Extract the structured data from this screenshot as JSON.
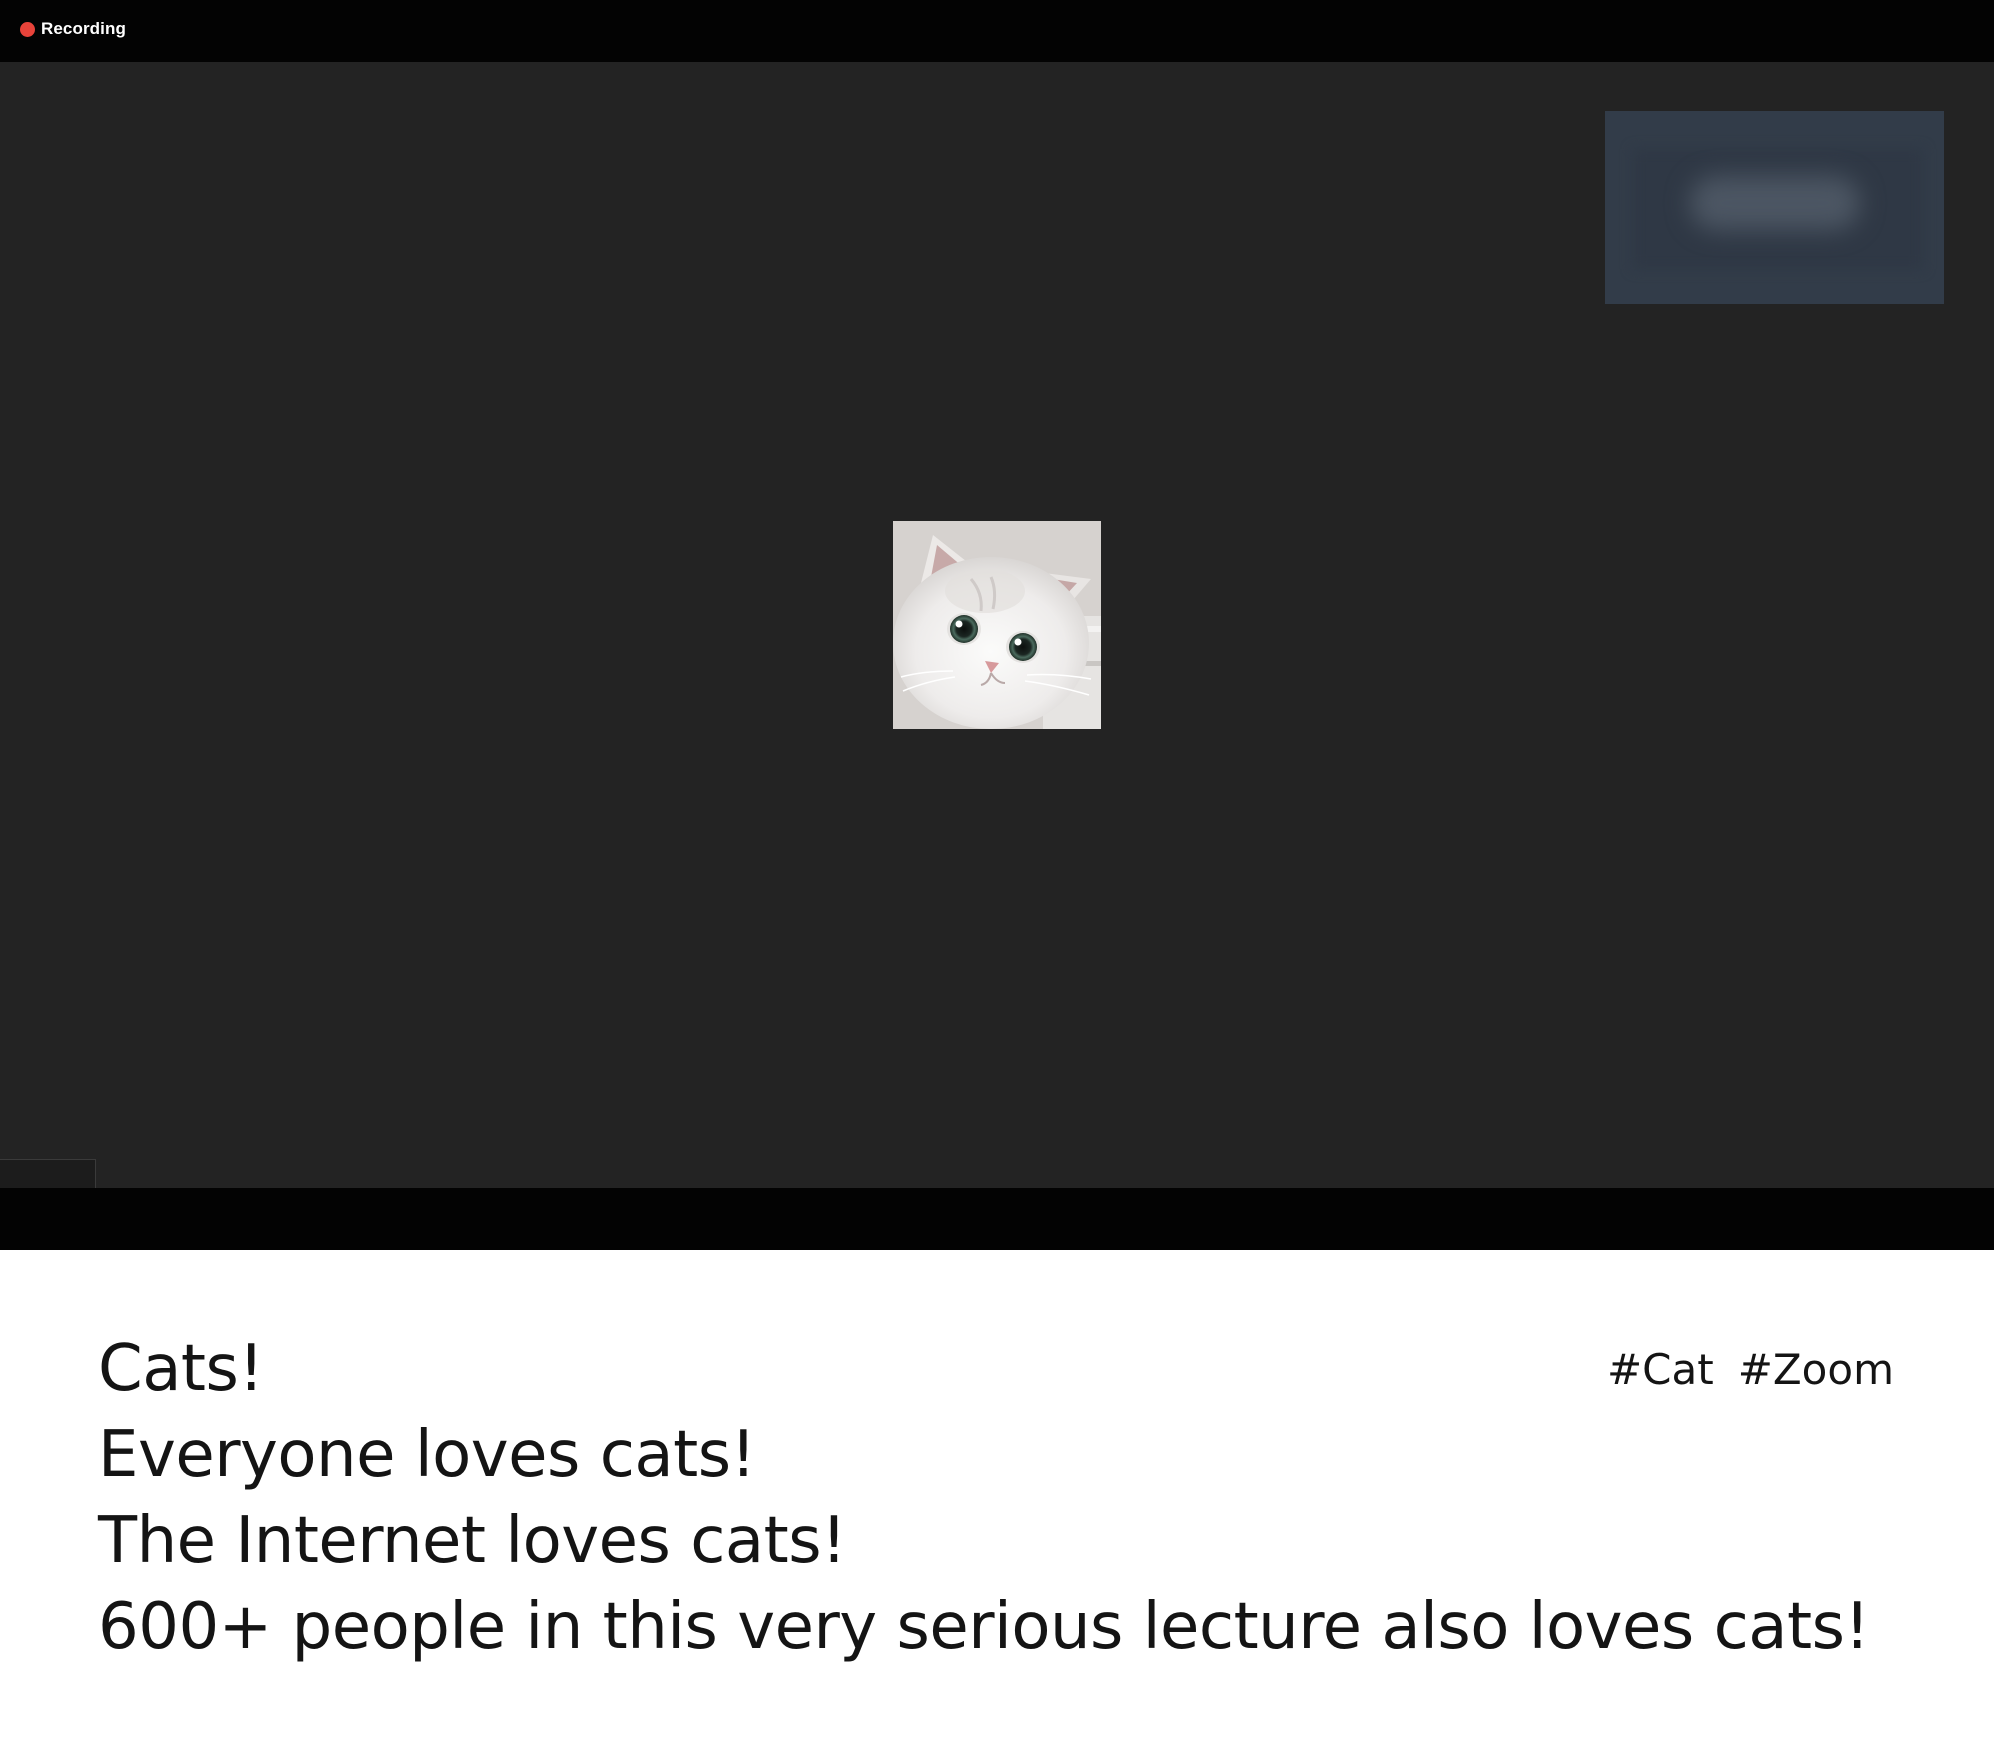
{
  "recording": {
    "label": "Recording",
    "dot_color": "#e8433a"
  },
  "meeting": {
    "stage_color": "#232323",
    "self_view": {
      "state": "blurred"
    },
    "participant": {
      "avatar": "cat-photo"
    }
  },
  "caption": {
    "lines": [
      "Cats!",
      "Everyone loves cats!",
      "The Internet loves cats!",
      "600+ people in this very serious lecture also loves cats!"
    ],
    "hashtags": [
      "#Cat",
      "#Zoom"
    ]
  }
}
